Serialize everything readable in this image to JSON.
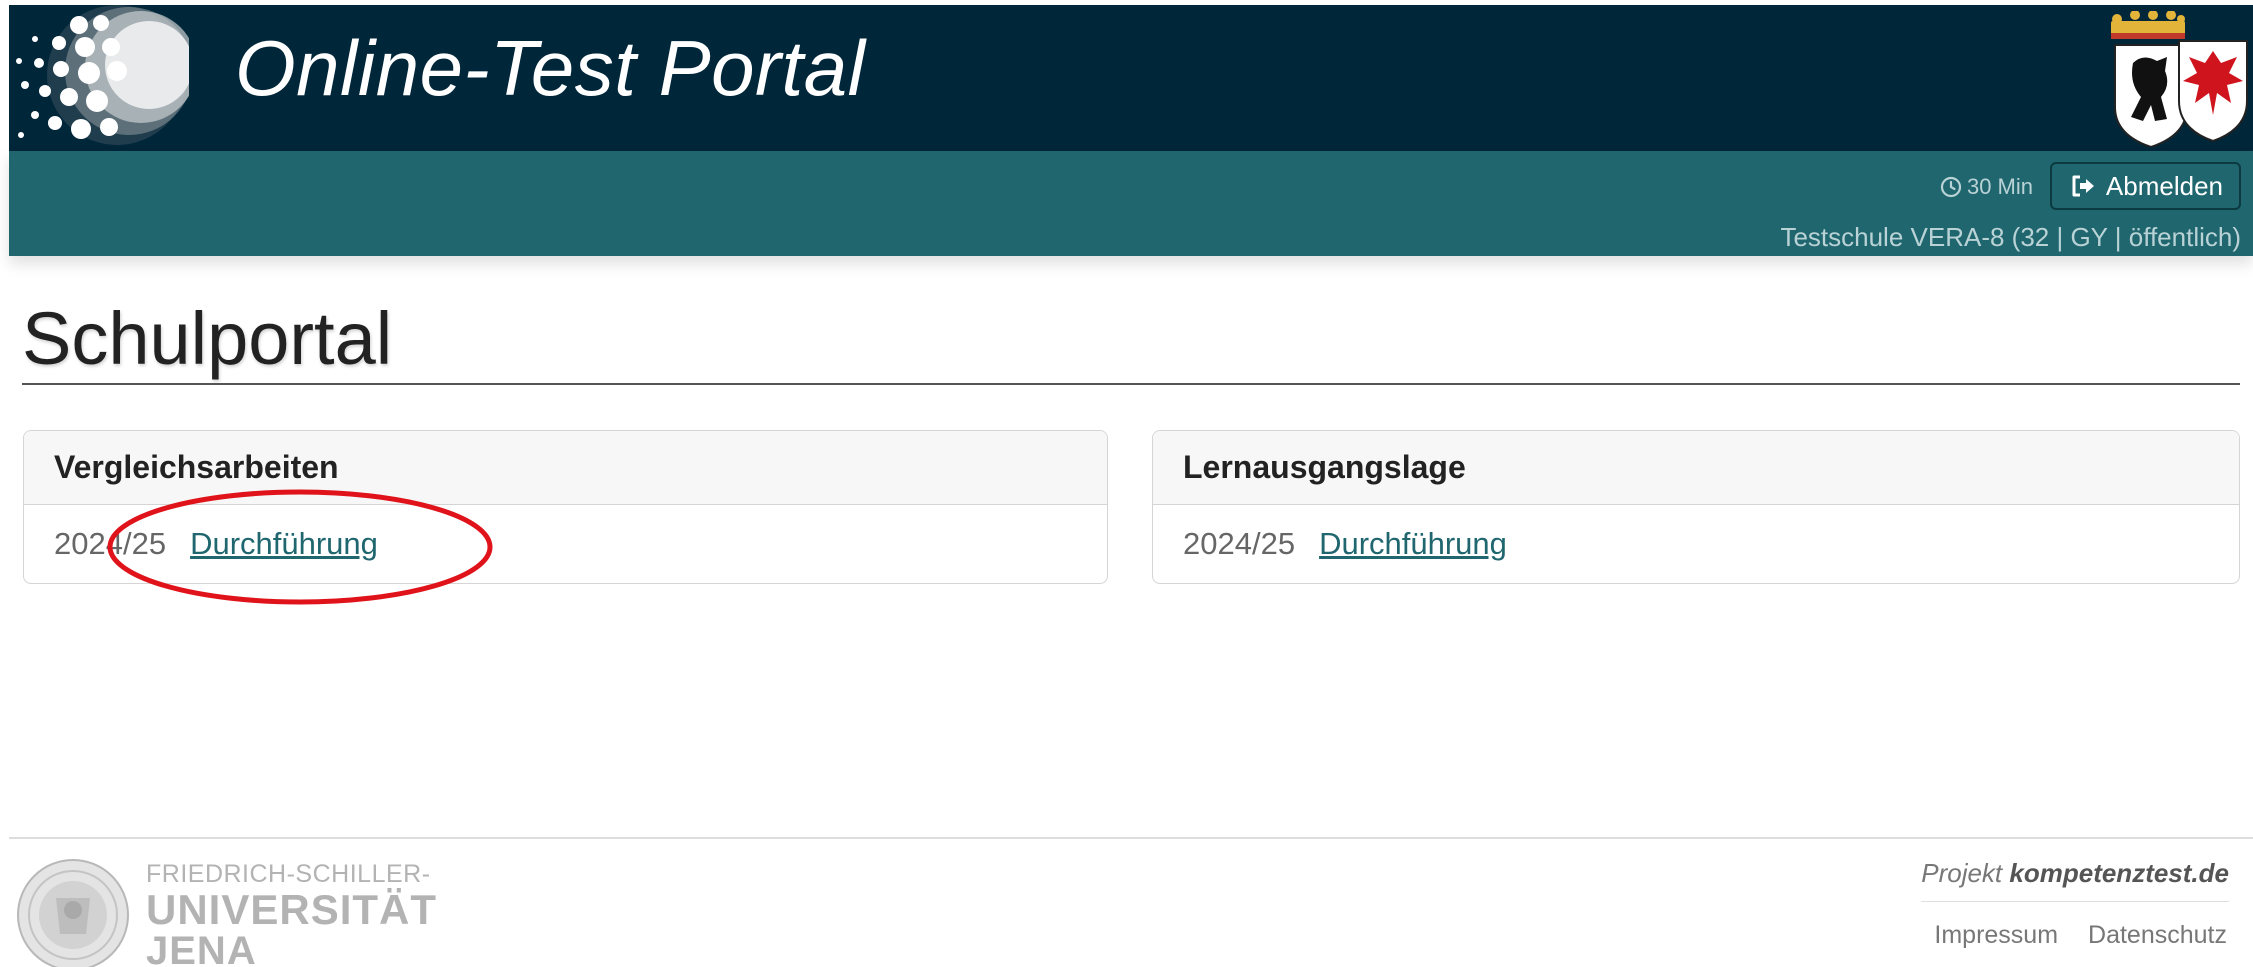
{
  "header": {
    "app_title": "Online-Test Portal",
    "timer": "30 Min",
    "logout_label": "Abmelden",
    "school_name": "Testschule VERA-8 (32 | GY | öffentlich)"
  },
  "main": {
    "page_title": "Schulportal",
    "cards": [
      {
        "title": "Vergleichsarbeiten",
        "year": "2024/25",
        "link": "Durchführung"
      },
      {
        "title": "Lernausgangslage",
        "year": "2024/25",
        "link": "Durchführung"
      }
    ]
  },
  "footer": {
    "university": {
      "line1": "FRIEDRICH-SCHILLER-",
      "line2": "UNIVERSITÄT",
      "line3": "JENA"
    },
    "project_prefix": "Projekt",
    "project_brand": "kompetenztest.de",
    "links": [
      "Impressum",
      "Datenschutz"
    ]
  },
  "colors": {
    "header_dark": "#00263a",
    "header_teal": "#1f666f",
    "highlight": "#e0131b"
  },
  "icons": {
    "logo": "dotted-sphere-logo",
    "timer": "clock-icon",
    "logout": "sign-out-icon",
    "arms": "berlin-brandenburg-coat-of-arms",
    "seal": "university-seal"
  }
}
